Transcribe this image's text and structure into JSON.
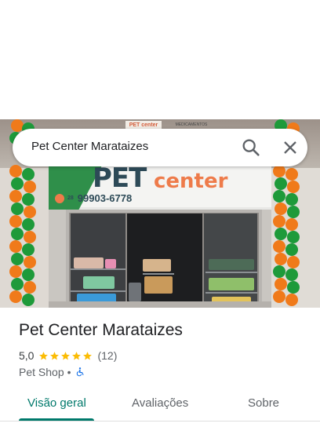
{
  "search": {
    "query": "Pet Center Marataizes",
    "search_icon": "search-icon",
    "close_icon": "close-icon"
  },
  "photo": {
    "brand_pet": "PET",
    "brand_center": "center",
    "phone_ddd": "28",
    "phone_number": "99903-6778",
    "sign_top": "PET center",
    "sign_top2": "MEDICAMENTOS"
  },
  "place": {
    "name": "Pet Center Marataizes",
    "rating": "5,0",
    "stars": 5,
    "review_count": "(12)",
    "category": "Pet Shop",
    "separator": "•",
    "accessibility_icon": "wheelchair-icon"
  },
  "tabs": [
    {
      "label": "Visão geral",
      "active": true
    },
    {
      "label": "Avaliações",
      "active": false
    },
    {
      "label": "Sobre",
      "active": false
    }
  ],
  "colors": {
    "accent": "#00796b",
    "star": "#fbbc04",
    "accessibility": "#1a73e8"
  }
}
